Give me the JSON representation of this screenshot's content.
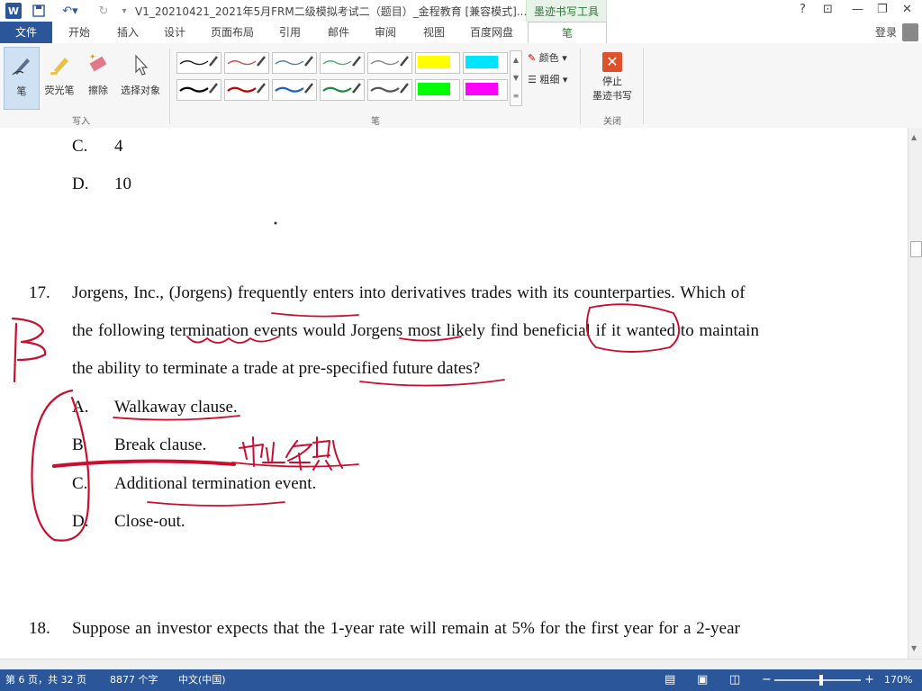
{
  "titlebar": {
    "title": "V1_20210421_2021年5月FRM二级模拟考试二（题目）_金程教育 [兼容模式]...",
    "ink_tools_label": "墨迹书写工具",
    "help": "?",
    "minimize": "—",
    "restore": "❐",
    "close": "✕"
  },
  "tabs": {
    "file": "文件",
    "items": [
      "开始",
      "插入",
      "设计",
      "页面布局",
      "引用",
      "邮件",
      "审阅",
      "视图",
      "百度网盘",
      "笔"
    ],
    "login": "登录"
  },
  "ribbon": {
    "write_tools": [
      {
        "label": "笔",
        "icon": "pen-icon"
      },
      {
        "label": "荧光笔",
        "icon": "highlighter-icon"
      },
      {
        "label": "擦除",
        "icon": "eraser-icon"
      },
      {
        "label": "选择对象",
        "icon": "select-pointer-icon"
      }
    ],
    "write_group": "写入",
    "pen_group": "笔",
    "close_group": "关闭",
    "color_label": "颜色",
    "thickness_label": "粗细",
    "stop_label_1": "停止",
    "stop_label_2": "墨迹书写",
    "pen_row1": [
      "#222222",
      "#c0504d",
      "#4f81bd",
      "#4caf6a",
      "#888888",
      "#ffff00",
      "#00e5ff"
    ],
    "pen_row2": [
      "#000000",
      "#c00000",
      "#1f5fbf",
      "#1e8a3c",
      "#555555",
      "#00ff00",
      "#ff00ff"
    ]
  },
  "document": {
    "option_c_prev": {
      "letter": "C.",
      "text": "4"
    },
    "option_d_prev": {
      "letter": "D.",
      "text": "10"
    },
    "q17_number": "17.",
    "q17_line1": "Jorgens, Inc., (Jorgens) frequently enters into derivatives trades with its counterparties. Which of",
    "q17_line2": "the following termination events would Jorgens most likely find beneficial if it wanted to maintain",
    "q17_line3": "the ability to terminate a trade at pre-specified future dates?",
    "options": [
      {
        "letter": "A.",
        "text": "Walkaway clause."
      },
      {
        "letter": "B.",
        "text": "Break clause."
      },
      {
        "letter": "C.",
        "text": "Additional termination event."
      },
      {
        "letter": "D.",
        "text": "Close-out."
      }
    ],
    "q18_number": "18.",
    "q18_line1": "Suppose an investor expects that the 1-year rate will remain at 5% for the first year for a 2-year",
    "handwritten_answer": "B",
    "handwritten_note": "中止条款"
  },
  "statusbar": {
    "page": "第 6 页，共 32 页",
    "words": "8877 个字",
    "language": "中文(中国)",
    "zoom": "170%"
  }
}
